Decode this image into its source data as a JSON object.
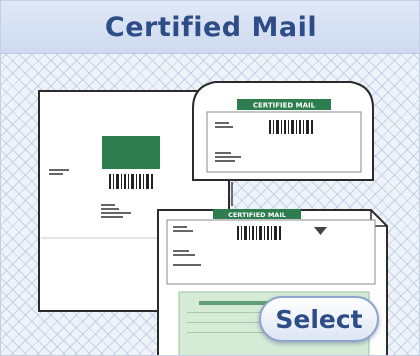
{
  "card": {
    "title": "Certified Mail",
    "select_label": "Select"
  },
  "illustration": {
    "envelope_label": "CERTIFIED MAIL",
    "form_label": "CERTIFIED MAIL",
    "accent_color": "#2e7d4f",
    "title_color": "#2e4d86"
  }
}
